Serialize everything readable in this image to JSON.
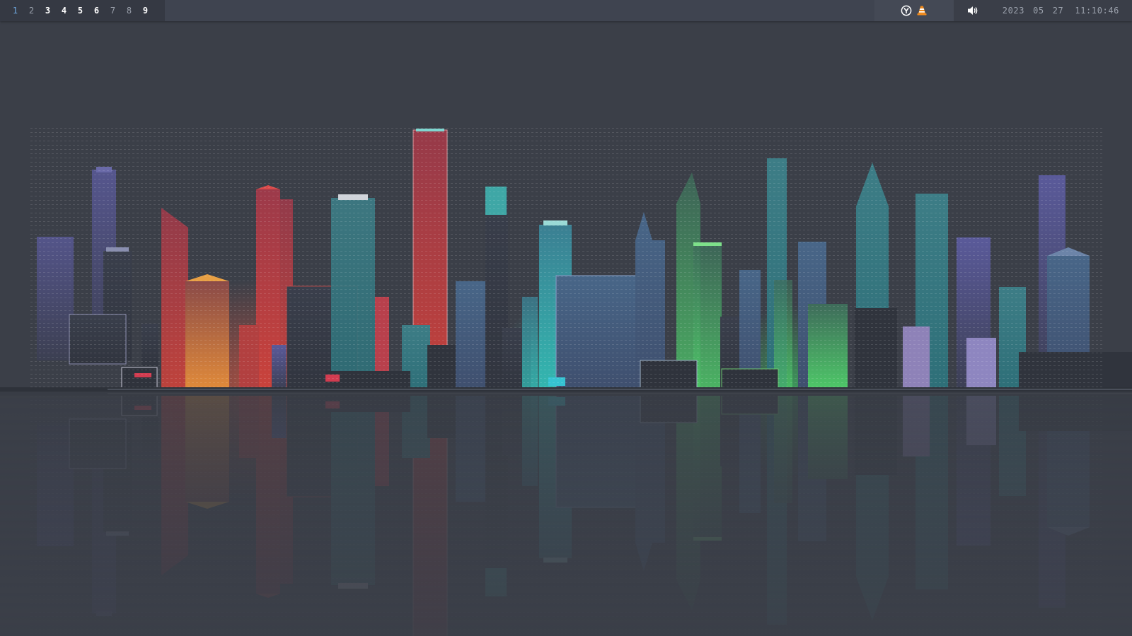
{
  "workspaces": [
    {
      "label": "1",
      "state": "active"
    },
    {
      "label": "2",
      "state": "empty"
    },
    {
      "label": "3",
      "state": "occupied"
    },
    {
      "label": "4",
      "state": "occupied"
    },
    {
      "label": "5",
      "state": "occupied"
    },
    {
      "label": "6",
      "state": "occupied"
    },
    {
      "label": "7",
      "state": "empty"
    },
    {
      "label": "8",
      "state": "empty"
    },
    {
      "label": "9",
      "state": "occupied"
    }
  ],
  "tray": {
    "icons": [
      "yubikey-icon",
      "vlc-icon"
    ]
  },
  "volume": {
    "icon": "speaker-icon"
  },
  "clock": {
    "year": "2023",
    "month": "05",
    "day": "27",
    "time": "11:10:46"
  },
  "colors": {
    "bar": "#3f4450",
    "workspace_bg": "#353943",
    "active_workspace": "#6ea8e0",
    "desktop": "#3b3f48"
  }
}
